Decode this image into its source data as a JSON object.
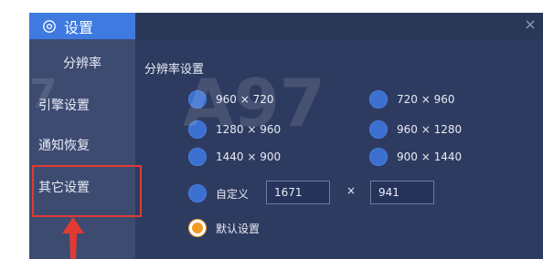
{
  "window": {
    "title": "设置",
    "close_label": "×"
  },
  "sidebar": {
    "items": [
      {
        "label": "分辨率"
      },
      {
        "label": "引擎设置"
      },
      {
        "label": "通知恢复"
      },
      {
        "label": "其它设置"
      }
    ]
  },
  "resolution": {
    "section_title": "分辨率设置",
    "options": [
      {
        "label": "960 × 720"
      },
      {
        "label": "720 × 960"
      },
      {
        "label": "1280 × 960"
      },
      {
        "label": "960 × 1280"
      },
      {
        "label": "1440 × 900"
      },
      {
        "label": "900 × 1440"
      }
    ],
    "custom": {
      "label": "自定义",
      "width": "1671",
      "times": "×",
      "height": "941"
    },
    "default_label": "默认设置",
    "selected": "默认设置"
  },
  "colors": {
    "accent": "#3e7ae0",
    "selected_radio": "#f39a22",
    "highlight": "#e23a32"
  }
}
